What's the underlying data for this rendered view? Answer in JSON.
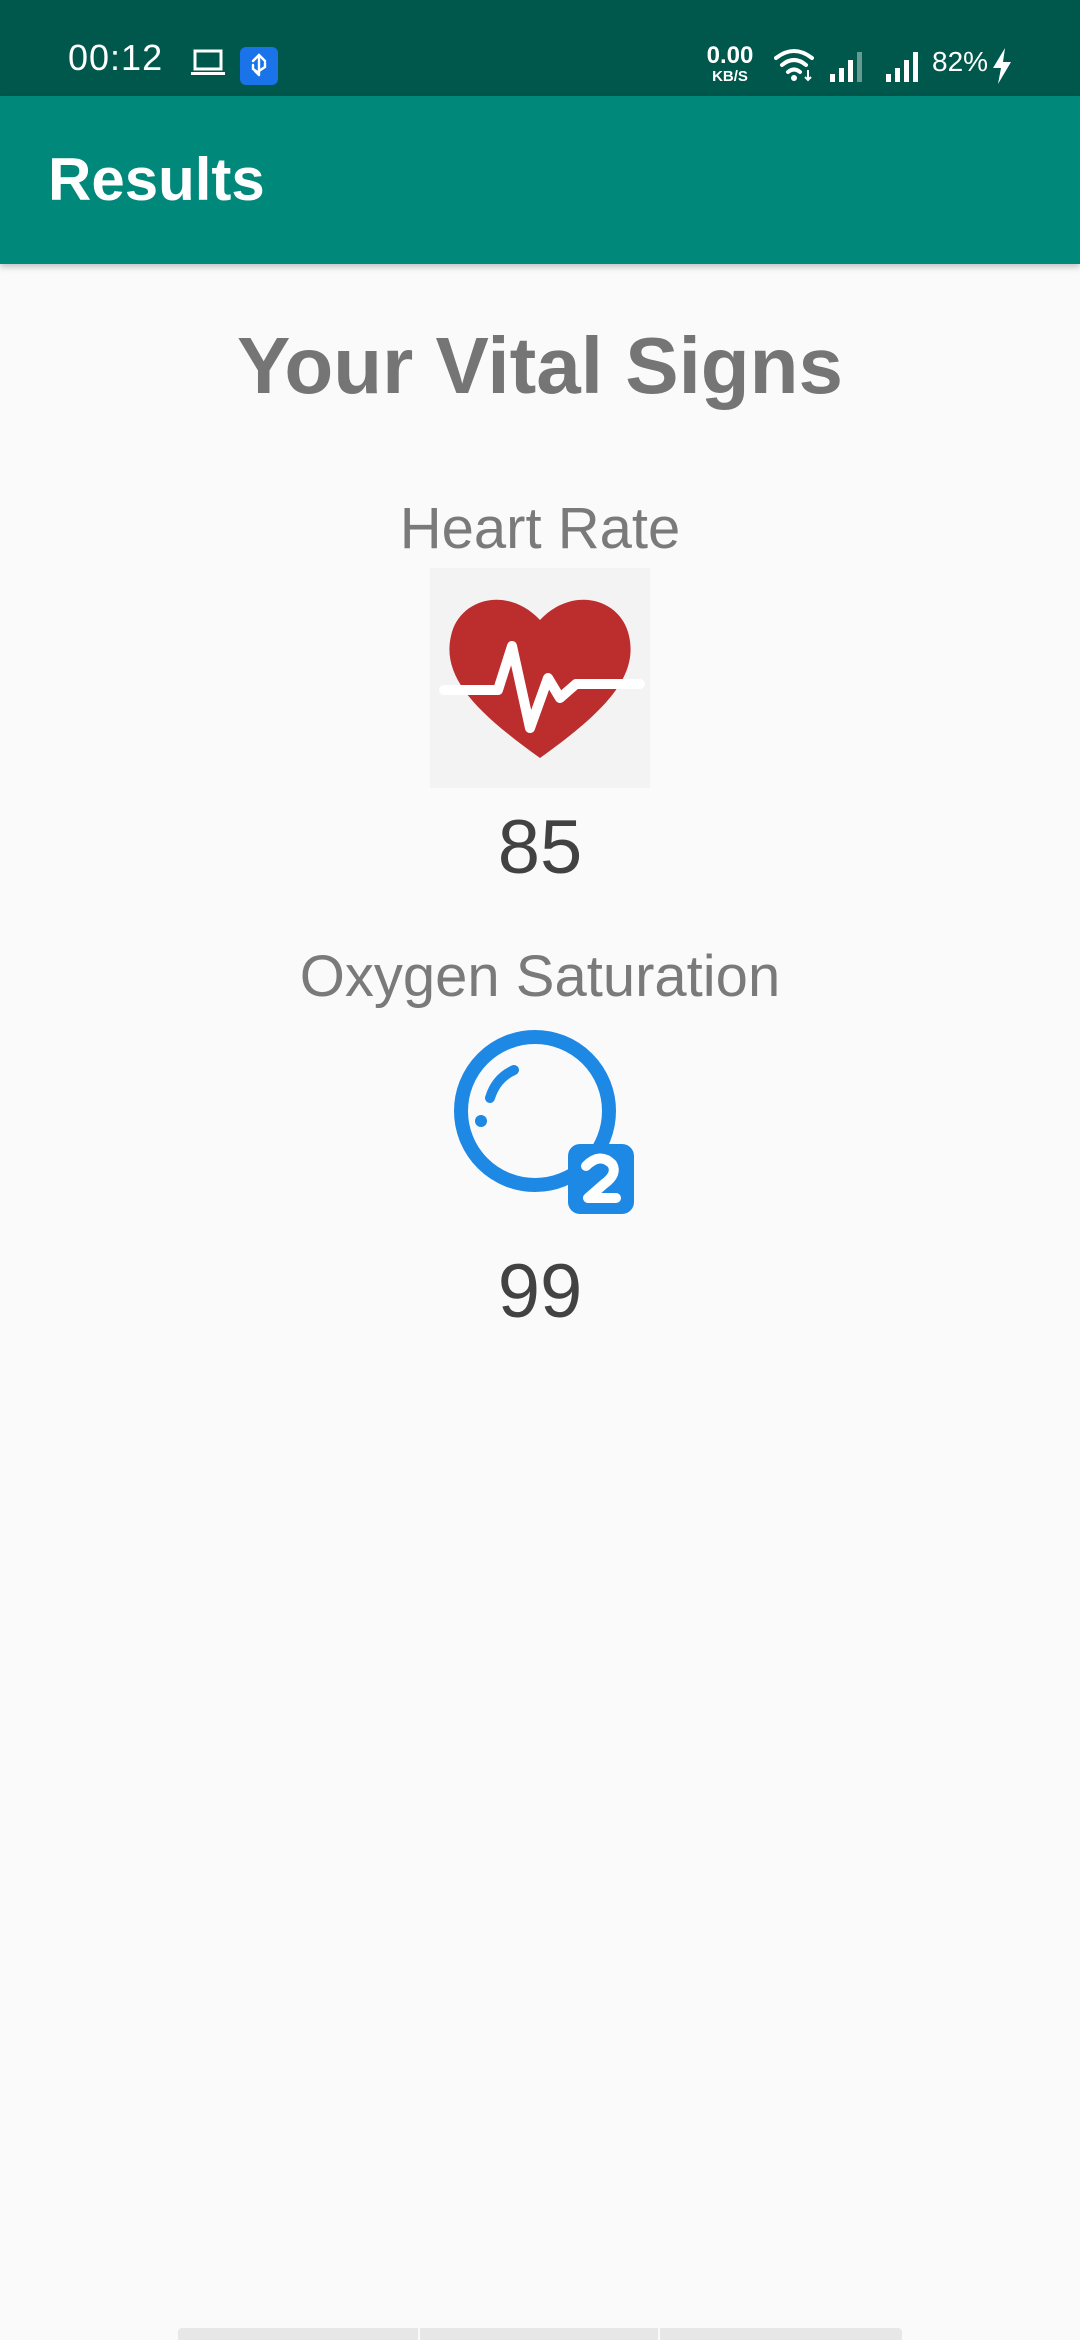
{
  "status_bar": {
    "time": "00:12",
    "net_speed_value": "0.00",
    "net_speed_unit": "KB/S",
    "battery_percent": "82%",
    "icons": [
      "laptop-icon",
      "usb-debug-icon",
      "wifi-icon",
      "signal-icon",
      "signal-icon",
      "charging-icon"
    ],
    "background_color": "#00574b"
  },
  "app_bar": {
    "title": "Results",
    "background_color": "#00897b"
  },
  "main": {
    "heading": "Your Vital Signs",
    "vitals": [
      {
        "label": "Heart Rate",
        "value": "85",
        "icon": "heart-rate-icon",
        "icon_color": "#b71c1c"
      },
      {
        "label": "Oxygen Saturation",
        "value": "99",
        "icon": "oxygen-o2-icon",
        "icon_color": "#1e88e5"
      }
    ]
  }
}
